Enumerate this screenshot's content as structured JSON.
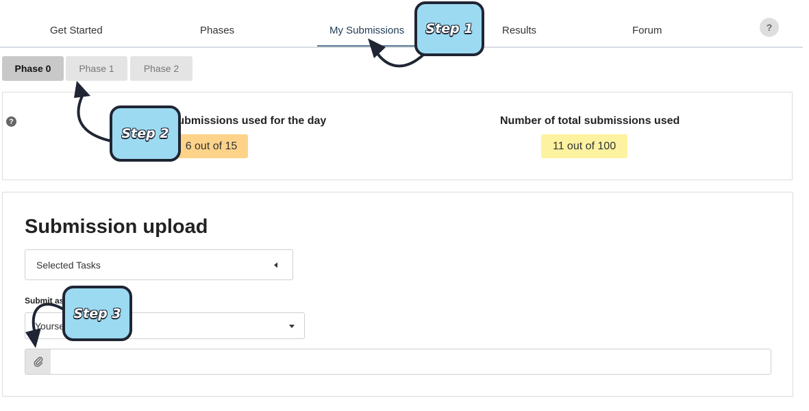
{
  "nav": {
    "items": [
      "Get Started",
      "Phases",
      "My Submissions",
      "Results",
      "Forum"
    ],
    "help": "?"
  },
  "phases": [
    "Phase 0",
    "Phase 1",
    "Phase 2"
  ],
  "stats": {
    "daily_label": "Number of submissions used for the day",
    "daily_value": "6 out of 15",
    "total_label": "Number of total submissions used",
    "total_value": "11 out of 100",
    "help": "?"
  },
  "upload": {
    "title": "Submission upload",
    "tasks_select": "Selected Tasks",
    "submit_as_label": "Submit as",
    "submit_as_help": "?",
    "submit_as_value": "Yourself"
  },
  "steps": [
    "Step 1",
    "Step 2",
    "Step 3"
  ],
  "colors": {
    "daily_badge": "#fdd38a",
    "total_badge": "#fdf2a0",
    "step_bubble": "#9cdaf1",
    "step_border": "#1f2533",
    "active_link": "#1f3b57"
  },
  "icons": {
    "attach": "paperclip-icon",
    "help": "question-circle-icon"
  }
}
